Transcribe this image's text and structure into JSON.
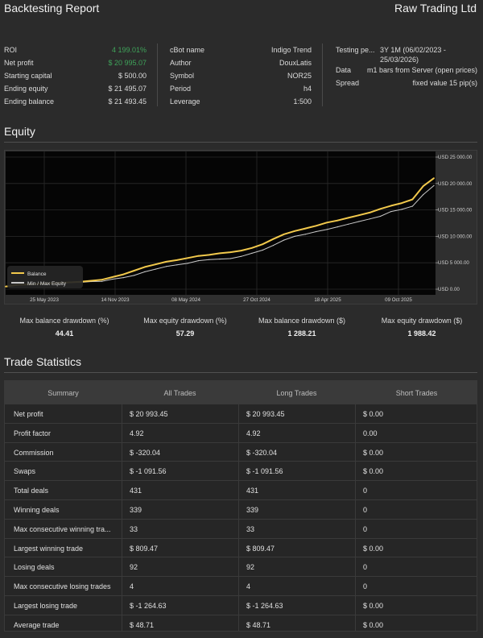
{
  "header": {
    "title": "Backtesting Report",
    "company": "Raw Trading Ltd"
  },
  "summary": [
    {
      "label": "ROI",
      "value": "4 199.01%",
      "accent": true
    },
    {
      "label": "Net profit",
      "value": "$ 20 995.07",
      "accent": true
    },
    {
      "label": "Starting capital",
      "value": "$ 500.00"
    },
    {
      "label": "Ending equity",
      "value": "$ 21 495.07"
    },
    {
      "label": "Ending balance",
      "value": "$ 21 493.45"
    }
  ],
  "bot": [
    {
      "label": "cBot name",
      "value": "Indigo Trend"
    },
    {
      "label": "Author",
      "value": "DouxLatis"
    },
    {
      "label": "Symbol",
      "value": "NOR25"
    },
    {
      "label": "Period",
      "value": "h4"
    },
    {
      "label": "Leverage",
      "value": "1:500"
    }
  ],
  "testing": [
    {
      "label": "Testing pe...",
      "value": "3Y 1M (06/02/2023 -",
      "value2": "25/03/2026)"
    },
    {
      "label": "Data",
      "value": "m1 bars from Server (open prices)"
    },
    {
      "label": "Spread",
      "value": "fixed value 15 pip(s)"
    }
  ],
  "equity_section": {
    "title": "Equity"
  },
  "chart_data": {
    "type": "line",
    "y_ticks": [
      "USD 25 000.00",
      "USD 20 000.00",
      "USD 15 000.00",
      "USD 10 000.00",
      "USD 5 000.00",
      "USD 0.00"
    ],
    "y_tick_values": [
      25000,
      20000,
      15000,
      10000,
      5000,
      0
    ],
    "ylim": [
      0,
      25000
    ],
    "x_ticks": [
      "25 May 2023",
      "14 Nov 2023",
      "08 May 2024",
      "27 Oct 2024",
      "18 Apr 2025",
      "09 Oct 2025"
    ],
    "legend": [
      "Balance",
      "Min / Max Equity"
    ],
    "legend_position": "bottom-left",
    "series": [
      {
        "name": "Balance",
        "color": "#f2c94c",
        "x": [
          0,
          1,
          2,
          3,
          4,
          5,
          6,
          7,
          8,
          9,
          10,
          11,
          12,
          13,
          14,
          15,
          16,
          17,
          18,
          19,
          20,
          21,
          22,
          23,
          24,
          25,
          26,
          27,
          28,
          29,
          30,
          31,
          32,
          33,
          34,
          35,
          36,
          37,
          38,
          39,
          40
        ],
        "values": [
          500,
          800,
          900,
          1000,
          1100,
          1200,
          1300,
          1400,
          1600,
          1800,
          2300,
          2800,
          3500,
          4200,
          4700,
          5200,
          5500,
          5900,
          6300,
          6500,
          6800,
          7000,
          7300,
          7800,
          8500,
          9500,
          10400,
          11000,
          11500,
          12000,
          12600,
          13000,
          13500,
          14000,
          14500,
          15200,
          15800,
          16300,
          17000,
          19500,
          21000
        ]
      },
      {
        "name": "Min / Max Equity",
        "color": "#c8c8c8",
        "x": [
          0,
          1,
          2,
          3,
          4,
          5,
          6,
          7,
          8,
          9,
          10,
          11,
          12,
          13,
          14,
          15,
          16,
          17,
          18,
          19,
          20,
          21,
          22,
          23,
          24,
          25,
          26,
          27,
          28,
          29,
          30,
          31,
          32,
          33,
          34,
          35,
          36,
          37,
          38,
          39,
          40
        ],
        "values": [
          500,
          750,
          850,
          950,
          1050,
          1150,
          1250,
          1300,
          1450,
          1500,
          1900,
          2200,
          2600,
          3300,
          3800,
          4300,
          4600,
          4900,
          5400,
          5600,
          5700,
          5800,
          6200,
          6800,
          7400,
          8300,
          9300,
          10000,
          10400,
          10900,
          11300,
          11800,
          12300,
          12800,
          13300,
          13800,
          14700,
          15100,
          15700,
          17900,
          19600
        ]
      }
    ]
  },
  "drawdowns": [
    {
      "label": "Max balance drawdown (%)",
      "value": "44.41"
    },
    {
      "label": "Max equity drawdown (%)",
      "value": "57.29"
    },
    {
      "label": "Max balance drawdown ($)",
      "value": "1 288.21"
    },
    {
      "label": "Max equity drawdown ($)",
      "value": "1 988.42"
    }
  ],
  "trade_section": {
    "title": "Trade Statistics"
  },
  "table": {
    "headers": [
      "Summary",
      "All Trades",
      "Long Trades",
      "Short Trades"
    ],
    "rows": [
      [
        "Net profit",
        "$ 20 993.45",
        "$ 20 993.45",
        "$ 0.00"
      ],
      [
        "Profit factor",
        "4.92",
        "4.92",
        "0.00"
      ],
      [
        "Commission",
        "$ -320.04",
        "$ -320.04",
        "$ 0.00"
      ],
      [
        "Swaps",
        "$ -1 091.56",
        "$ -1 091.56",
        "$ 0.00"
      ],
      [
        "Total deals",
        "431",
        "431",
        "0"
      ],
      [
        "Winning deals",
        "339",
        "339",
        "0"
      ],
      [
        "Max consecutive winning tra...",
        "33",
        "33",
        "0"
      ],
      [
        "Largest winning trade",
        "$ 809.47",
        "$ 809.47",
        "$ 0.00"
      ],
      [
        "Losing deals",
        "92",
        "92",
        "0"
      ],
      [
        "Max consecutive losing trades",
        "4",
        "4",
        "0"
      ],
      [
        "Largest losing trade",
        "$ -1 264.63",
        "$ -1 264.63",
        "$ 0.00"
      ],
      [
        "Average trade",
        "$ 48.71",
        "$ 48.71",
        "$ 0.00"
      ]
    ]
  }
}
